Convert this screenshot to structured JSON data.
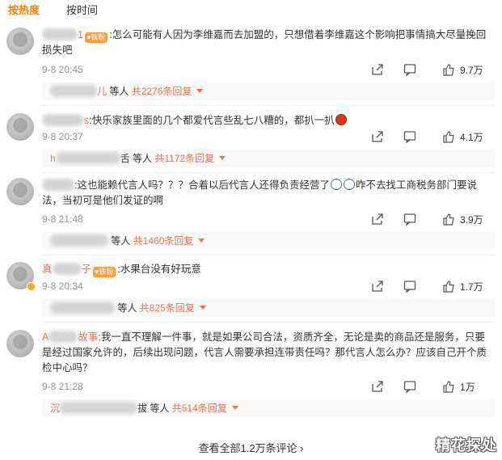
{
  "tabs": [
    {
      "label": "按热度",
      "active": true
    },
    {
      "label": "按时间",
      "active": false
    }
  ],
  "fan_badge_label": "铁粉",
  "comments": [
    {
      "name_prefix": "",
      "name_suffix": "1",
      "has_fan_badge": true,
      "text": ":怎么可能有人因为李维嘉而去加盟的，只想借着李维嘉这个影响把事情搞大尽量挽回损失吧",
      "time": "9-8 20:45",
      "likes": "9.7万",
      "reply_user_suffix": "儿",
      "reply_label": " 等人 ",
      "reply_count": "共2276条回复"
    },
    {
      "name_prefix": "",
      "name_suffix": "s",
      "has_fan_badge": false,
      "text": ":快乐家族里面的几个都爱代言些乱七八糟的，都扒一扒",
      "time": "9-8 20:37",
      "likes": "4.1万",
      "reply_user_suffix": "h",
      "reply_label": "舌 等人 ",
      "reply_count": "共1172条回复"
    },
    {
      "name_prefix": "",
      "name_suffix": "",
      "has_fan_badge": false,
      "text": ":这也能赖代言人吗？？？合着以后代言人还得负责经营了",
      "text_tail": "咋不去找工商税务部门要说法，当初可是他们发证的啊",
      "time": "9-8 21:48",
      "likes": "3.9万",
      "reply_user_suffix": "",
      "reply_label": " 等人 ",
      "reply_count": "共1460条回复"
    },
    {
      "name_prefix": "真",
      "name_suffix": "子",
      "has_fan_badge": true,
      "text": ":水果台没有好玩意",
      "time": "9-8 20:34",
      "likes": "1.7万",
      "reply_user_suffix": "",
      "reply_label": " 等人 ",
      "reply_count": "共825条回复"
    },
    {
      "name_prefix": "A",
      "name_suffix": "故事",
      "has_fan_badge": false,
      "text": ":我一直不理解一件事，就是如果公司合法，资质齐全，无论是卖的商品还是服务，只要是经过国家允许的，后续出现问题，代言人需要承担连带责任吗？那代言人怎么办？应该自己开个质检中心吗？",
      "time": "9-8 21:28",
      "likes": "1万",
      "reply_user_suffix": "沉",
      "reply_label": "拔 等人 ",
      "reply_count": "共514条回复"
    }
  ],
  "view_all": "查看全部1.2万条评论 ›",
  "watermark": "精花探处"
}
